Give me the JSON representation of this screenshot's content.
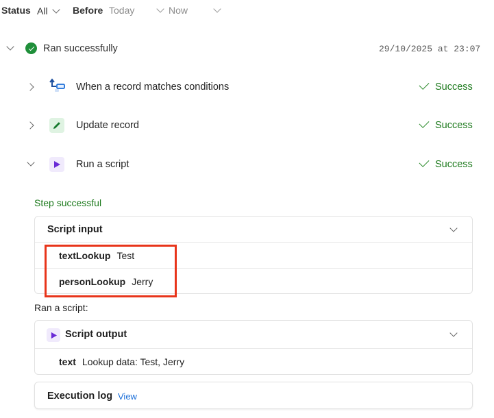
{
  "filters": {
    "status_label": "Status",
    "status_value": "All",
    "before_label": "Before",
    "before_placeholder": "Today",
    "now_value": "Now"
  },
  "run": {
    "status": "Ran successfully",
    "timestamp": "29/10/2025 at 23:07"
  },
  "steps": [
    {
      "title": "When a record matches conditions",
      "status": "Success",
      "icon": "trigger-icon"
    },
    {
      "title": "Update record",
      "status": "Success",
      "icon": "pencil-icon"
    },
    {
      "title": "Run a script",
      "status": "Success",
      "icon": "play-icon"
    }
  ],
  "detail": {
    "step_status": "Step successful",
    "script_input": {
      "title": "Script input",
      "rows": [
        {
          "key": "textLookup",
          "value": "Test"
        },
        {
          "key": "personLookup",
          "value": "Jerry"
        }
      ]
    },
    "ran_label": "Ran a script:",
    "script_output": {
      "title": "Script output",
      "rows": [
        {
          "key": "text",
          "value": "Lookup data: Test, Jerry"
        }
      ]
    },
    "execution_log": {
      "title": "Execution log",
      "link": "View"
    }
  },
  "colors": {
    "success": "#1d7a1d",
    "accent_purple": "#6a2bd6",
    "highlight": "#e8341a",
    "link": "#1a6ed8"
  }
}
